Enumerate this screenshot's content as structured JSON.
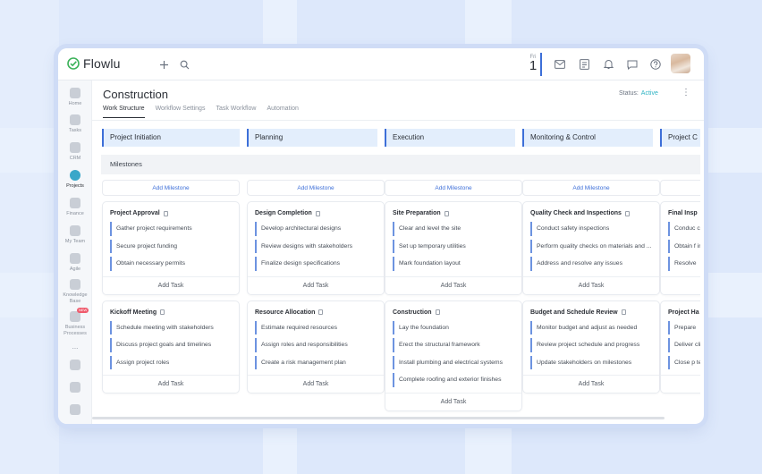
{
  "app": {
    "name": "Flowlu"
  },
  "topbar": {
    "date_day": "Fri",
    "date_num": "1"
  },
  "sidebar": {
    "items": [
      {
        "label": "Home",
        "icon": "home-icon"
      },
      {
        "label": "Tasks",
        "icon": "tasks-icon"
      },
      {
        "label": "CRM",
        "icon": "crm-icon"
      },
      {
        "label": "Projects",
        "icon": "projects-icon",
        "active": true
      },
      {
        "label": "Finance",
        "icon": "finance-icon"
      },
      {
        "label": "My Team",
        "icon": "team-icon"
      },
      {
        "label": "Agile",
        "icon": "agile-icon"
      },
      {
        "label": "Knowledge Base",
        "icon": "knowledge-icon"
      },
      {
        "label": "Business Processes",
        "icon": "processes-icon",
        "badge": "NEW"
      },
      {
        "label": "...",
        "icon": "more-icon"
      }
    ]
  },
  "page": {
    "title": "Construction",
    "status_label": "Status:",
    "status_value": "Active",
    "tabs": [
      "Work Structure",
      "Workflow Settings",
      "Task Workflow",
      "Automation"
    ]
  },
  "board": {
    "milestones_label": "Milestones",
    "add_milestone": "Add Milestone",
    "add_task": "Add Task",
    "phases": [
      {
        "name": "Project Initiation",
        "cards": [
          {
            "title": "Project Approval",
            "tasks": [
              "Gather project requirements",
              "Secure project funding",
              "Obtain necessary permits"
            ]
          },
          {
            "title": "Kickoff Meeting",
            "tasks": [
              "Schedule meeting with stakeholders",
              "Discuss project goals and timelines",
              "Assign project roles"
            ]
          }
        ]
      },
      {
        "name": "Planning",
        "cards": [
          {
            "title": "Design Completion",
            "tasks": [
              "Develop architectural designs",
              "Review designs with stakeholders",
              "Finalize design specifications"
            ]
          },
          {
            "title": "Resource Allocation",
            "tasks": [
              "Estimate required resources",
              "Assign roles and responsibilities",
              "Create a risk management plan"
            ]
          }
        ]
      },
      {
        "name": "Execution",
        "cards": [
          {
            "title": "Site Preparation",
            "tasks": [
              "Clear and level the site",
              "Set up temporary utilities",
              "Mark foundation layout"
            ]
          },
          {
            "title": "Construction",
            "tasks": [
              "Lay the foundation",
              "Erect the structural framework",
              "Install plumbing and electrical systems",
              "Complete roofing and exterior finishes"
            ]
          }
        ]
      },
      {
        "name": "Monitoring & Control",
        "cards": [
          {
            "title": "Quality Check and Inspections",
            "tasks": [
              "Conduct safety inspections",
              "Perform quality checks on materials and ...",
              "Address and resolve any issues"
            ]
          },
          {
            "title": "Budget and Schedule Review",
            "tasks": [
              "Monitor budget and adjust as needed",
              "Review project schedule and progress",
              "Update stakeholders on milestones"
            ]
          }
        ]
      },
      {
        "name": "Project C",
        "cards": [
          {
            "title": "Final Insp",
            "tasks": [
              "Conduc client",
              "Obtain f inspecti",
              "Resolve"
            ]
          },
          {
            "title": "Project Ha",
            "tasks": [
              "Prepare",
              "Deliver clie...",
              "Close p team"
            ]
          }
        ]
      }
    ]
  }
}
